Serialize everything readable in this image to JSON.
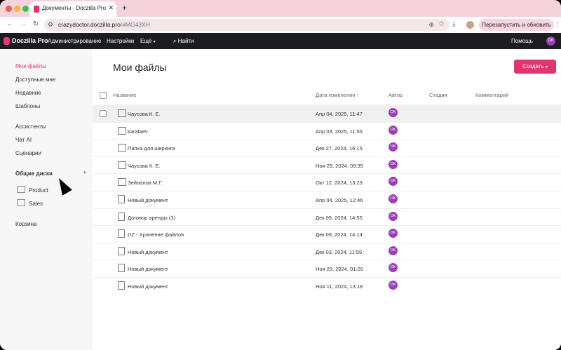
{
  "browser": {
    "tab_title": "Документы - Doczilla Pro",
    "tab_close": "✕",
    "new_tab": "+",
    "url_host": "crazydoctor.doczilla.pro",
    "url_hash": "/#MG43XH",
    "relaunch_label": "Перезапустить и обновить"
  },
  "appbar": {
    "logo": "Doczilla Pro",
    "nav": [
      "Администрирование",
      "Настройки",
      "Ещё",
      "Найти"
    ],
    "help": "Помощь",
    "avatar": "DK"
  },
  "sidebar": {
    "items": [
      "Мои файлы",
      "Доступные мне",
      "Недавние",
      "Шаблоны",
      "Ассистенты",
      "Чат AI",
      "Сценарии"
    ],
    "shared_heading": "Общие диски",
    "shared": [
      "Product",
      "Sales"
    ],
    "trash": "Корзина"
  },
  "main": {
    "title": "Мои файлы",
    "create_label": "Создать",
    "columns": [
      "Название",
      "Дата изменения ↑",
      "Автор",
      "Стадия",
      "Комментарий"
    ]
  },
  "files": [
    {
      "name": "Чаусова К. Е.",
      "date": "Апр 04, 2025, 11:47",
      "owner": "OK",
      "kind": "shared-folder"
    },
    {
      "name": "karataev",
      "date": "Апр 03, 2025, 11:55",
      "owner": "OK",
      "kind": "shared-folder"
    },
    {
      "name": "Папка для шеринга",
      "date": "Дек 27, 2024, 16:15",
      "owner": "OK",
      "kind": "folder"
    },
    {
      "name": "Чаусова К. Е.",
      "date": "Ноя 29, 2024, 09:35",
      "owner": "OK",
      "kind": "folder"
    },
    {
      "name": "Зейналов М.Г.",
      "date": "Окт 12, 2024, 13:23",
      "owner": "OK",
      "kind": "folder"
    },
    {
      "name": "Новый документ",
      "date": "Апр 04, 2025, 12:46",
      "owner": "OK",
      "kind": "doc"
    },
    {
      "name": "Договор аренды (3)",
      "date": "Дек 09, 2024, 14:55",
      "owner": "OK",
      "kind": "doc"
    },
    {
      "name": "DZ - Хранение файлов",
      "date": "Дек 09, 2024, 14:14",
      "owner": "OK",
      "kind": "doc"
    },
    {
      "name": "Новый документ",
      "date": "Дек 03, 2024, 11:55",
      "owner": "OK",
      "kind": "doc"
    },
    {
      "name": "Новый документ",
      "date": "Ноя 29, 2024, 01:26",
      "owner": "OK",
      "kind": "doc"
    },
    {
      "name": "Новый документ",
      "date": "Ноя 11, 2024, 13:18",
      "owner": "OK",
      "kind": "doc"
    }
  ],
  "colors": {
    "accent": "#e2356f",
    "owner_badge": "#9b3fb5",
    "appbar": "#1c1c22"
  }
}
